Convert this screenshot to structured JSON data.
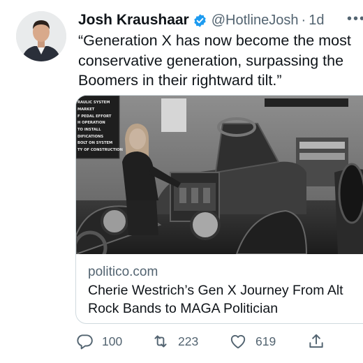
{
  "tweet": {
    "author_name": "Josh Kraushaar",
    "handle": "@HotlineJosh",
    "separator": "·",
    "time": "1d",
    "more_label": "•••",
    "text": "“Generation X has now become the most conservative generation, surpassing the Boomers in their rightward tilt.”"
  },
  "card": {
    "domain": "politico.com",
    "title": "Cherie Westrich’s Gen X Journey From Alt Rock Bands to MAGA Politician",
    "sign_lines": [
      "RAULIC SYSTEM",
      "MARKET",
      "F PEDAL EFFORT",
      "H OPERATION",
      "TO INSTALL",
      "DIFICATIONS",
      "BOLT ON SYSTEM",
      "TY OF CONSTRUCTION"
    ]
  },
  "actions": {
    "replies": "100",
    "retweets": "223",
    "likes": "619"
  },
  "colors": {
    "verified": "#1d9bf0",
    "secondary_text": "#536471",
    "border": "#cfd9de"
  },
  "icons": {
    "reply": "speech-bubble-icon",
    "retweet": "retweet-arrows-icon",
    "like": "heart-icon",
    "share": "share-upload-icon",
    "verified": "verified-badge-icon"
  }
}
